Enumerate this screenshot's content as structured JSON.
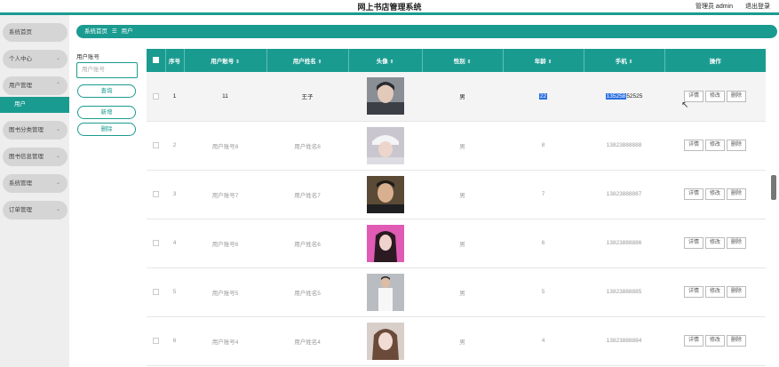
{
  "header": {
    "title": "网上书店管理系统",
    "user_label": "管理员 admin",
    "logout_label": "退出登录"
  },
  "sidebar": {
    "items": [
      {
        "label": "系统首页",
        "chevron": ""
      },
      {
        "label": "个人中心",
        "chevron": "⌄"
      },
      {
        "label": "用户管理",
        "chevron": "⌃"
      },
      {
        "label": "图书分类管理",
        "chevron": "⌄"
      },
      {
        "label": "图书信息管理",
        "chevron": "⌄"
      },
      {
        "label": "系统管理",
        "chevron": "⌄"
      },
      {
        "label": "订单管理",
        "chevron": "⌄"
      }
    ],
    "active_sub": "用户"
  },
  "breadcrumb": {
    "home": "系统首页",
    "separator": "☰",
    "current": "用户"
  },
  "filter": {
    "label": "用户账号",
    "placeholder": "用户账号",
    "query_button": "查询",
    "add_button": "新增",
    "delete_button": "删除"
  },
  "table": {
    "headers": [
      "序号",
      "用户账号",
      "用户姓名",
      "头像",
      "性别",
      "年龄",
      "手机",
      "操作"
    ],
    "sort_glyph": "⇕",
    "rows": [
      {
        "index": "1",
        "account": "11",
        "name": "王子",
        "gender": "男",
        "age": "22",
        "phone_selected": "135258",
        "phone_rest": "52525"
      },
      {
        "index": "2",
        "account": "用户账号8",
        "name": "用户姓名8",
        "gender": "男",
        "age": "8",
        "phone": "13823888888"
      },
      {
        "index": "3",
        "account": "用户账号7",
        "name": "用户姓名7",
        "gender": "男",
        "age": "7",
        "phone": "13823888887"
      },
      {
        "index": "4",
        "account": "用户账号6",
        "name": "用户姓名6",
        "gender": "男",
        "age": "6",
        "phone": "13823888886"
      },
      {
        "index": "5",
        "account": "用户账号5",
        "name": "用户姓名5",
        "gender": "男",
        "age": "5",
        "phone": "13823888885"
      },
      {
        "index": "6",
        "account": "用户账号4",
        "name": "用户姓名4",
        "gender": "男",
        "age": "4",
        "phone": "13823888884"
      }
    ],
    "actions": {
      "detail": "详情",
      "edit": "修改",
      "delete": "删除"
    }
  },
  "colors": {
    "accent": "#1a9b90",
    "selection": "#2a6fe0"
  }
}
